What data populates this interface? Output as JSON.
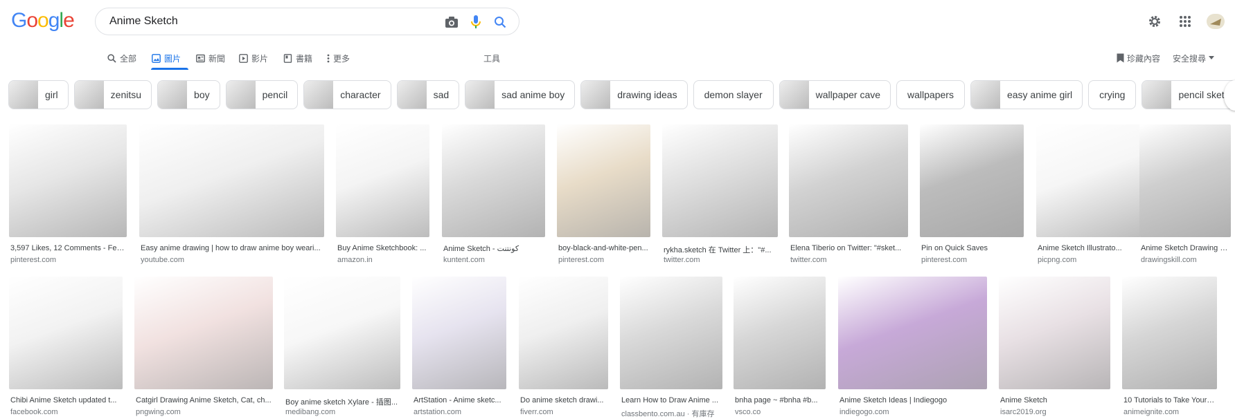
{
  "logo": {
    "letters": [
      "G",
      "o",
      "o",
      "g",
      "l",
      "e"
    ],
    "colors": [
      "#4285F4",
      "#EA4335",
      "#FBBC05",
      "#4285F4",
      "#34A853",
      "#EA4335"
    ]
  },
  "search": {
    "value": "Anime Sketch"
  },
  "nav": {
    "all": "全部",
    "images": "圖片",
    "news": "新聞",
    "videos": "影片",
    "books": "書籍",
    "more": "更多",
    "tools": "工具",
    "saved": "珍藏內容",
    "safesearch": "安全搜尋"
  },
  "chips": [
    "girl",
    "zenitsu",
    "boy",
    "pencil",
    "character",
    "sad",
    "sad anime boy",
    "drawing ideas",
    "demon slayer",
    "wallpaper cave",
    "wallpapers",
    "easy anime girl",
    "crying",
    "pencil sketch"
  ],
  "row1": [
    {
      "title": "3,597 Likes, 12 Comments - Fea...",
      "source": "pinterest.com"
    },
    {
      "title": "Easy anime drawing | how to draw anime boy weari...",
      "source": "youtube.com"
    },
    {
      "title": "Buy Anime Sketchbook: ...",
      "source": "amazon.in"
    },
    {
      "title": "Anime Sketch - كونتنت",
      "source": "kuntent.com"
    },
    {
      "title": "boy-black-and-white-pen...",
      "source": "pinterest.com"
    },
    {
      "title": "rykha.sketch 在 Twitter 上：\"#...",
      "source": "twitter.com"
    },
    {
      "title": "Elena Tiberio on Twitter: \"#sket...",
      "source": "twitter.com"
    },
    {
      "title": "Pin on Quick Saves",
      "source": "pinterest.com"
    },
    {
      "title": "Anime Sketch Illustrato...",
      "source": "picpng.com"
    },
    {
      "title": "Anime Sketch Drawing P...",
      "source": "drawingskill.com"
    }
  ],
  "row2": [
    {
      "title": "Chibi Anime Sketch updated t...",
      "source": "facebook.com"
    },
    {
      "title": "Catgirl Drawing Anime Sketch, Cat, ch...",
      "source": "pngwing.com"
    },
    {
      "title": "Boy anime sketch Xylare - 插图...",
      "source": "medibang.com"
    },
    {
      "title": "ArtStation - Anime sketc...",
      "source": "artstation.com"
    },
    {
      "title": "Do anime sketch drawi...",
      "source": "fiverr.com"
    },
    {
      "title": "Learn How to Draw Anime ...",
      "source": "classbento.com.au · 有庫存"
    },
    {
      "title": "bnha page ~ #bnha #b...",
      "source": "vsco.co"
    },
    {
      "title": "Anime Sketch Ideas | Indiegogo",
      "source": "indiegogo.com"
    },
    {
      "title": "Anime Sketch",
      "source": "isarc2019.org"
    },
    {
      "title": "10 Tutorials to Take Your Ani...",
      "source": "animeignite.com"
    }
  ]
}
